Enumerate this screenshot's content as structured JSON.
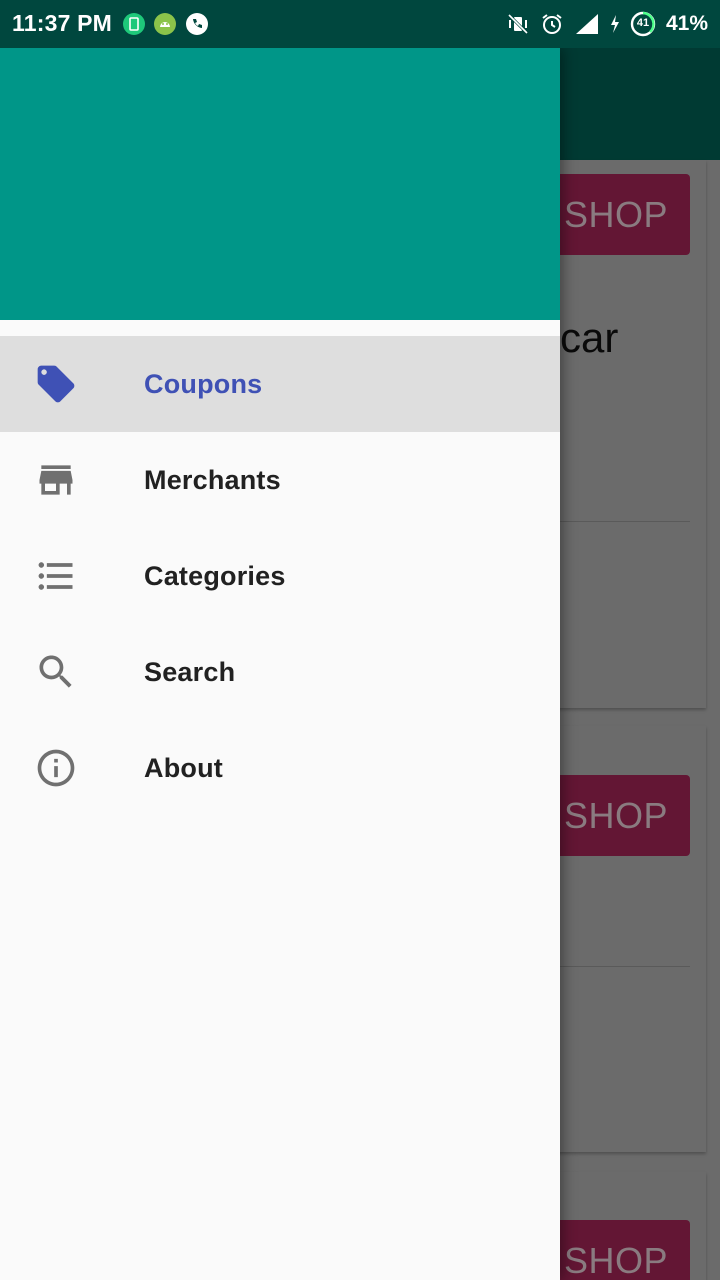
{
  "status_bar": {
    "time": "11:37 PM",
    "battery_text": "41%",
    "battery_ring_text": "41",
    "icons": [
      "notification-app-icon",
      "android-debug-icon",
      "phone-call-icon",
      "vibrate-off-icon",
      "alarm-icon",
      "signal-icon",
      "charging-icon",
      "battery-ring-icon"
    ]
  },
  "background": {
    "cards": [
      {
        "button_label": "SHOP",
        "snippet": "car"
      },
      {
        "button_label": "SHOP"
      },
      {
        "button_label": "SHOP"
      }
    ]
  },
  "drawer": {
    "header_color": "#009688",
    "items": [
      {
        "label": "Coupons",
        "icon": "tag-icon",
        "active": true
      },
      {
        "label": "Merchants",
        "icon": "store-icon",
        "active": false
      },
      {
        "label": "Categories",
        "icon": "list-icon",
        "active": false
      },
      {
        "label": "Search",
        "icon": "search-icon",
        "active": false
      },
      {
        "label": "About",
        "icon": "info-icon",
        "active": false
      }
    ]
  },
  "colors": {
    "accent": "#3f51b5",
    "status_bar": "#00473e",
    "drawer_header": "#009688",
    "shop_button": "#c2185b"
  }
}
